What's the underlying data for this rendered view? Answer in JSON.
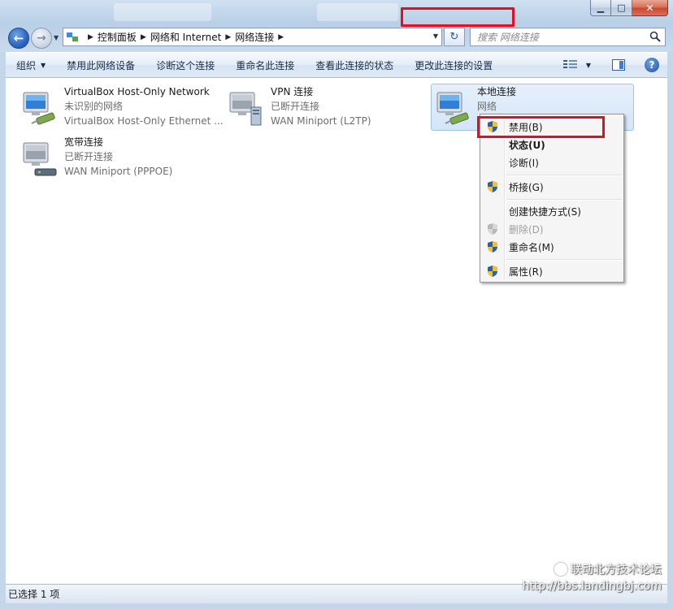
{
  "window": {
    "min_glyph": "▁",
    "max_glyph": "□",
    "close_glyph": "✕"
  },
  "nav": {
    "back_glyph": "←",
    "forward_glyph": "→",
    "dropdown_glyph": "▼",
    "refresh_glyph": "↻"
  },
  "address": {
    "separator": "▶",
    "crumbs": [
      "控制面板",
      "网络和 Internet",
      "网络连接"
    ],
    "dropdown_glyph": "▼"
  },
  "search": {
    "placeholder": "搜索 网络连接"
  },
  "toolbar": {
    "organize": "组织",
    "organize_caret": "▼",
    "disable_device": "禁用此网络设备",
    "diagnose": "诊断这个连接",
    "rename": "重命名此连接",
    "view_status": "查看此连接的状态",
    "change_settings": "更改此连接的设置",
    "view_caret": "▼",
    "help": "?"
  },
  "connections": [
    {
      "name": "VirtualBox Host-Only Network",
      "status": "未识别的网络",
      "device": "VirtualBox Host-Only Ethernet ..."
    },
    {
      "name": "VPN 连接",
      "status": "已断开连接",
      "device": "WAN Miniport (L2TP)"
    },
    {
      "name": "本地连接",
      "status": "网络",
      "device": ""
    },
    {
      "name": "宽带连接",
      "status": "已断开连接",
      "device": "WAN Miniport (PPPOE)"
    }
  ],
  "context_menu": {
    "disable": "禁用(B)",
    "status": "状态(U)",
    "diagnose": "诊断(I)",
    "bridge": "桥接(G)",
    "create_shortcut": "创建快捷方式(S)",
    "delete": "删除(D)",
    "rename": "重命名(M)",
    "properties": "属性(R)"
  },
  "statusbar": {
    "text": "已选择 1 项"
  },
  "watermark": {
    "line1": "联动北方技术论坛",
    "line2": "http://bbs.landingbj.com"
  },
  "colors": {
    "highlight_box": "#e01020",
    "selection_bg": "#d4e5f7",
    "link_blue": "#1a2c48"
  }
}
